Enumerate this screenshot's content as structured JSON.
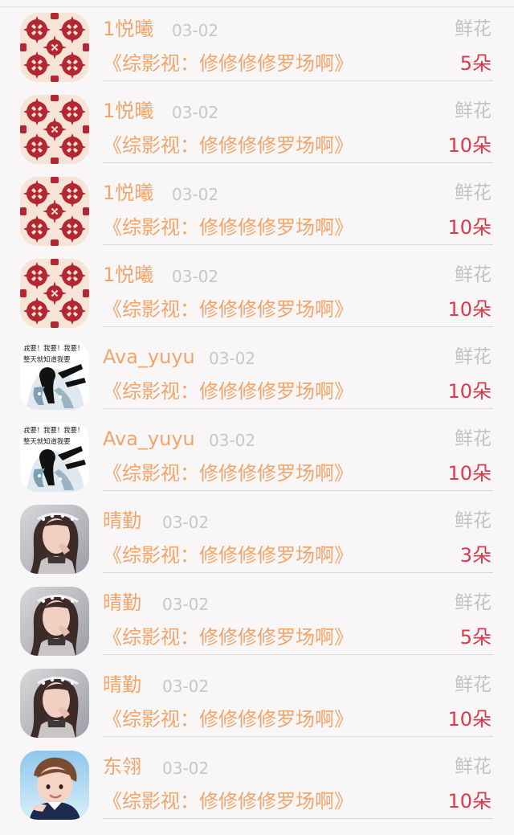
{
  "colors": {
    "name": "#f0a56a",
    "date": "#c8c6c8",
    "kind": "#c3c1c3",
    "count": "#d93a4c",
    "background": "#f8f6f7"
  },
  "rows": [
    {
      "name": "1悦曦",
      "date": "03-02",
      "kind": "鲜花",
      "book": "《综影视：修修修修罗场啊》",
      "count": "5朵",
      "avatar": "pattern-avatar"
    },
    {
      "name": "1悦曦",
      "date": "03-02",
      "kind": "鲜花",
      "book": "《综影视：修修修修罗场啊》",
      "count": "10朵",
      "avatar": "pattern-avatar"
    },
    {
      "name": "1悦曦",
      "date": "03-02",
      "kind": "鲜花",
      "book": "《综影视：修修修修罗场啊》",
      "count": "10朵",
      "avatar": "pattern-avatar"
    },
    {
      "name": "1悦曦",
      "date": "03-02",
      "kind": "鲜花",
      "book": "《综影视：修修修修罗场啊》",
      "count": "10朵",
      "avatar": "pattern-avatar"
    },
    {
      "name": "Ava_yuyu",
      "date": "03-02",
      "kind": "鲜花",
      "book": "《综影视：修修修修罗场啊》",
      "count": "10朵",
      "avatar": "meme-avatar",
      "avatar_text": [
        "我要！我要！我要！",
        "整天就知道我要"
      ]
    },
    {
      "name": "Ava_yuyu",
      "date": "03-02",
      "kind": "鲜花",
      "book": "《综影视：修修修修罗场啊》",
      "count": "10朵",
      "avatar": "meme-avatar",
      "avatar_text": [
        "我要！我要！我要！",
        "整天就知道我要"
      ]
    },
    {
      "name": "晴勤",
      "date": "03-02",
      "kind": "鲜花",
      "book": "《综影视：修修修修罗场啊》",
      "count": "3朵",
      "avatar": "portrait-avatar"
    },
    {
      "name": "晴勤",
      "date": "03-02",
      "kind": "鲜花",
      "book": "《综影视：修修修修罗场啊》",
      "count": "5朵",
      "avatar": "portrait-avatar"
    },
    {
      "name": "晴勤",
      "date": "03-02",
      "kind": "鲜花",
      "book": "《综影视：修修修修罗场啊》",
      "count": "10朵",
      "avatar": "portrait-avatar"
    },
    {
      "name": "东翎",
      "date": "03-02",
      "kind": "鲜花",
      "book": "《综影视：修修修修罗场啊》",
      "count": "10朵",
      "avatar": "child-avatar"
    }
  ]
}
